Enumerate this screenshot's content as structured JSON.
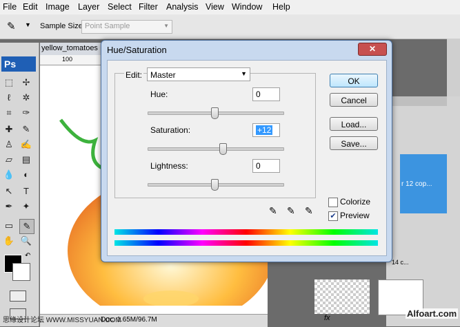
{
  "menu": [
    "File",
    "Edit",
    "Image",
    "Layer",
    "Select",
    "Filter",
    "Analysis",
    "View",
    "Window",
    "Help"
  ],
  "options_bar": {
    "sample_size_label": "Sample Size:",
    "sample_size_value": "Point Sample"
  },
  "app_logo": "Ps",
  "document": {
    "tab_title": "yellow_tomatoes",
    "ruler_mark": "100",
    "status": "Doc: 1.65M/96.7M"
  },
  "layers_panel": {
    "layer_name": "r 12 cop...",
    "layer_name2": "14 c..."
  },
  "dialog": {
    "title": "Hue/Saturation",
    "edit_label": "Edit:",
    "edit_value": "Master",
    "hue_label": "Hue:",
    "hue_value": "0",
    "saturation_label": "Saturation:",
    "saturation_value": "+12",
    "lightness_label": "Lightness:",
    "lightness_value": "0",
    "ok": "OK",
    "cancel": "Cancel",
    "load": "Load...",
    "save": "Save...",
    "colorize": "Colorize",
    "preview": "Preview",
    "colorize_checked": false,
    "preview_checked": true
  },
  "watermark_left": "思缘设计论坛  WWW.MISSYUAN.COM",
  "watermark_right": "Alfoart.com"
}
